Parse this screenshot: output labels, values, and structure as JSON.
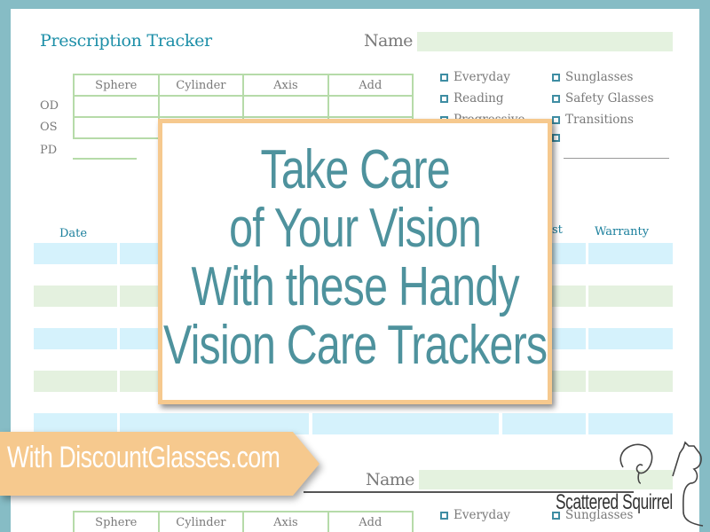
{
  "tracker": {
    "title": "Prescription Tracker",
    "name_label": "Name",
    "rx_columns": [
      "Sphere",
      "Cylinder",
      "Axis",
      "Add"
    ],
    "rx_rows": [
      "OD",
      "OS",
      "PD"
    ],
    "lens_types_left": [
      "Everyday",
      "Reading",
      "Progressive"
    ],
    "lens_types_right": [
      "Sunglasses",
      "Safety Glasses",
      "Transitions",
      ""
    ],
    "history_columns": {
      "date": "Date",
      "cost_partial": "st",
      "warranty": "Warranty"
    }
  },
  "overlay": {
    "headline_lines": [
      "Take Care",
      "of Your Vision",
      "With these Handy",
      "Vision Care Trackers"
    ],
    "banner": "With DiscountGlasses.com"
  },
  "second_tracker": {
    "name_label": "Name",
    "rx_columns": [
      "Sphere",
      "Cylinder",
      "Axis",
      "Add"
    ],
    "lens_types_left": [
      "Everyday"
    ],
    "lens_types_right": [
      "Sunglasses"
    ]
  },
  "logo": {
    "text": "Scattered Squirrel",
    "icon": "squirrel-icon"
  },
  "colors": {
    "frame": "#86bcc5",
    "accent_teal": "#4e929d",
    "title_blue": "#1d8fa8",
    "banner_orange": "#f6c98e",
    "stripe_blue": "#d5f2fc",
    "stripe_green": "#e4f1df",
    "table_border_green": "#b6dba9"
  }
}
